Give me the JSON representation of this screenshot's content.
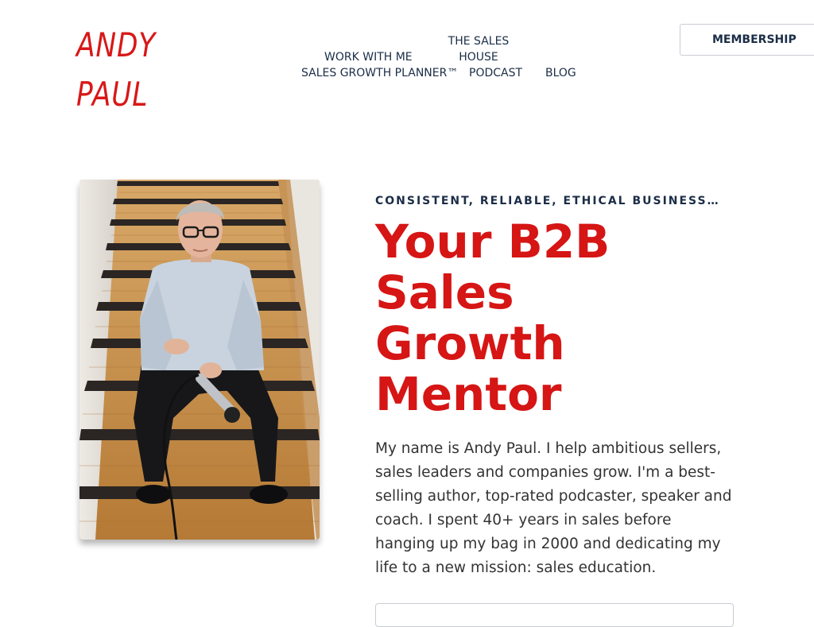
{
  "header": {
    "logo_line1": "ANDY",
    "logo_line2": "PAUL",
    "nav": {
      "the_sales_house_line1": "THE SALES",
      "the_sales_house_line2": "HOUSE",
      "work_with_me": "WORK WITH ME",
      "sales_growth_planner": "SALES GROWTH PLANNER™",
      "podcast": "PODCAST",
      "blog": "BLOG"
    },
    "membership_label": "MEMBERSHIP"
  },
  "hero": {
    "photo_icon": "portrait-photo",
    "eyebrow": "CONSISTENT, RELIABLE, ETHICAL BUSINESS…",
    "headline_lines": [
      "Your B2B",
      "Sales",
      "Growth",
      "Mentor"
    ],
    "intro": "My name is Andy Paul. I help ambitious sellers, sales leaders and companies grow. I'm a best-selling author, top-rated podcaster, speaker and coach. I spent 40+ years in sales before hanging up my bag in 2000 and dedicating my life to a new mission: sales education."
  },
  "colors": {
    "brand_red": "#d61515",
    "nav_navy": "#1b2d47",
    "body_text": "#333333"
  }
}
